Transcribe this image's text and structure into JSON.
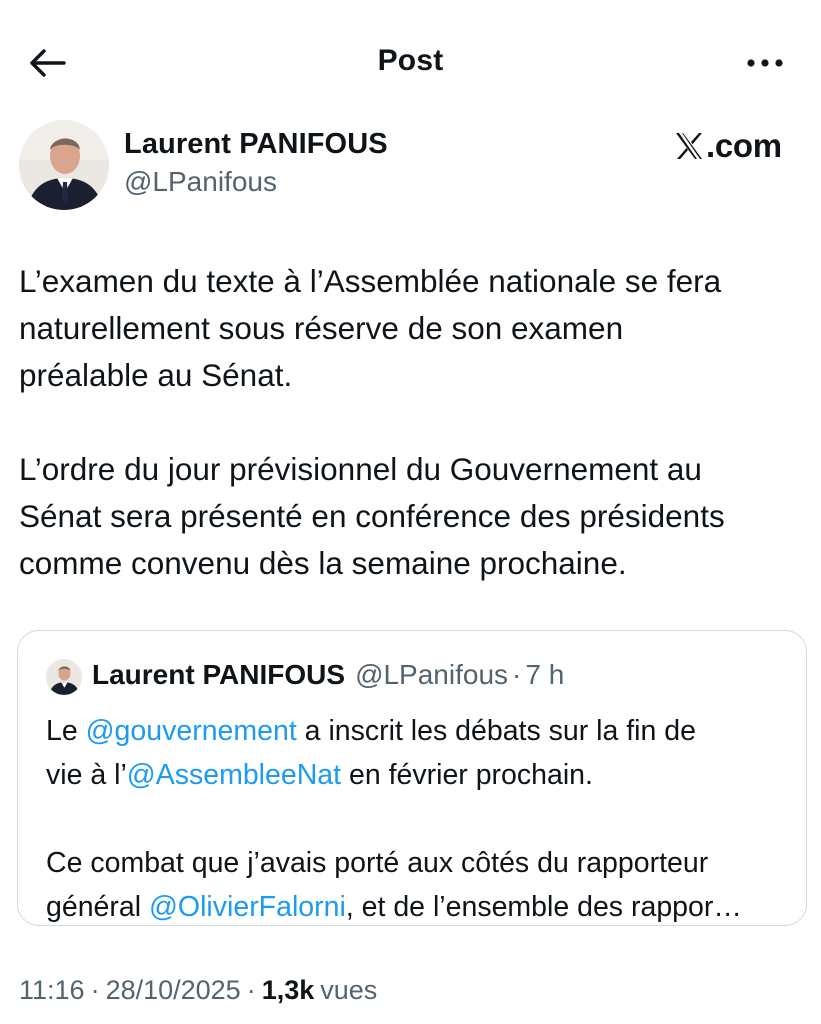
{
  "header": {
    "title": "Post",
    "back_icon": "arrow-left-icon",
    "more_icon": "more-horizontal-icon"
  },
  "author": {
    "name": "Laurent PANIFOUS",
    "handle": "@LPanifous",
    "avatar_icon": "profile-photo"
  },
  "brand": {
    "logo": "X",
    "text": ".com"
  },
  "post": {
    "paragraph1": [
      "L’examen du texte à l’Assemblée nationale se fera",
      "naturellement sous réserve de son examen",
      "préalable au Sénat."
    ],
    "paragraph2": [
      "L’ordre du jour prévisionnel du Gouvernement au",
      "Sénat sera présenté en conférence des présidents",
      "comme convenu dès la semaine prochaine."
    ]
  },
  "quoted": {
    "name": "Laurent PANIFOUS",
    "handle": "@LPanifous",
    "separator": "·",
    "time": "7 h",
    "line1": {
      "before": "Le ",
      "mention": "@gouvernement",
      "after": " a inscrit les débats sur la fin de"
    },
    "line2": {
      "before": "vie à l’",
      "mention": "@AssembleeNat",
      "after": " en février prochain."
    },
    "line3": {
      "text": "Ce combat que j’avais porté aux côtés du rapporteur"
    },
    "line4": {
      "before": "général ",
      "mention": "@OlivierFalorni",
      "after": ", et de l’ensemble des rappor…"
    }
  },
  "meta": {
    "time": "11:16",
    "separator": "·",
    "date": "28/10/2025",
    "views_count": "1,3k",
    "views_label": "vues"
  },
  "colors": {
    "text": "#0f1419",
    "secondary": "#536471",
    "link": "#1d9bf0",
    "border": "#cfd9de"
  }
}
